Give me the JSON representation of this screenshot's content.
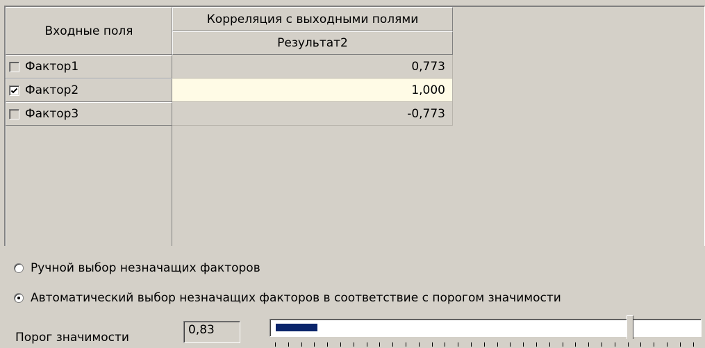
{
  "grid": {
    "input_fields_header": "Входные поля",
    "correlation_header": "Корреляция с выходными полями",
    "output_column_header": "Результат2",
    "rows": [
      {
        "label": "Фактор1",
        "checked": false,
        "value": "0,773"
      },
      {
        "label": "Фактор2",
        "checked": true,
        "value": "1,000"
      },
      {
        "label": "Фактор3",
        "checked": false,
        "value": "-0,773"
      }
    ],
    "selected_row_color": "#fffbe6"
  },
  "options": {
    "manual_label": "Ручной выбор незначащих факторов",
    "auto_label": "Автоматический выбор незначащих факторов в соответствие с порогом значимости",
    "selected": "auto"
  },
  "threshold": {
    "label": "Порог значимости",
    "value": "0,83"
  },
  "slider": {
    "position_fraction": 0.83,
    "selection_color": "#0a246a"
  },
  "icons": {
    "checkbox_checked": "check-mark-icon",
    "radio_selected": "radio-dot-icon"
  }
}
